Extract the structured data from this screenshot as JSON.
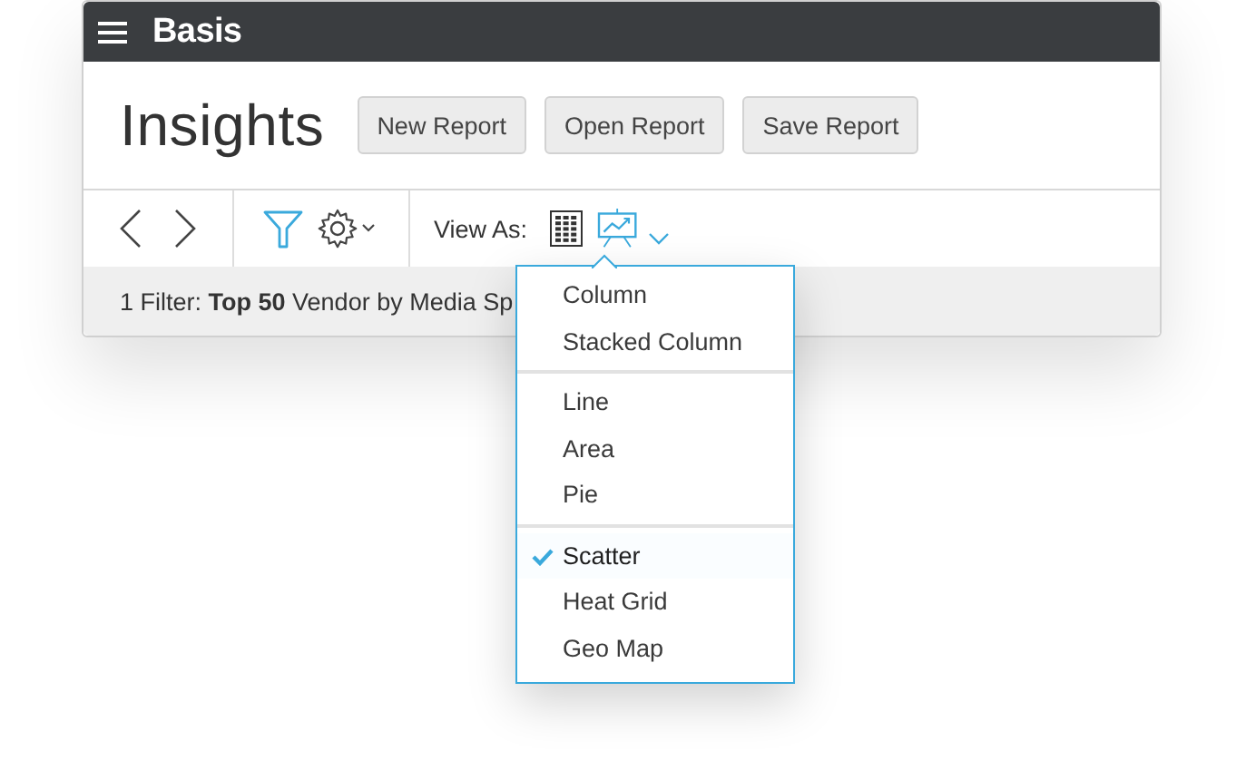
{
  "app": {
    "name": "Basis"
  },
  "page": {
    "title": "Insights"
  },
  "buttons": [
    {
      "label": "New Report"
    },
    {
      "label": "Open Report"
    },
    {
      "label": "Save Report"
    }
  ],
  "toolbar": {
    "view_as_label": "View As:",
    "views": [
      {
        "kind": "grid",
        "selected": false
      },
      {
        "kind": "chart",
        "selected": true
      }
    ]
  },
  "filter": {
    "text": "1 Filter: **Top 50** Vendor by Media Sp"
  },
  "view_menu": {
    "groups": [
      {
        "items": [
          {
            "label": "Column",
            "selected": false
          },
          {
            "label": "Stacked Column",
            "selected": false
          }
        ]
      },
      {
        "items": [
          {
            "label": "Line",
            "selected": false
          },
          {
            "label": "Area",
            "selected": false
          },
          {
            "label": "Pie",
            "selected": false
          }
        ]
      },
      {
        "items": [
          {
            "label": "Scatter",
            "selected": true
          },
          {
            "label": "Heat Grid",
            "selected": false
          },
          {
            "label": "Geo Map",
            "selected": false
          }
        ]
      }
    ]
  }
}
